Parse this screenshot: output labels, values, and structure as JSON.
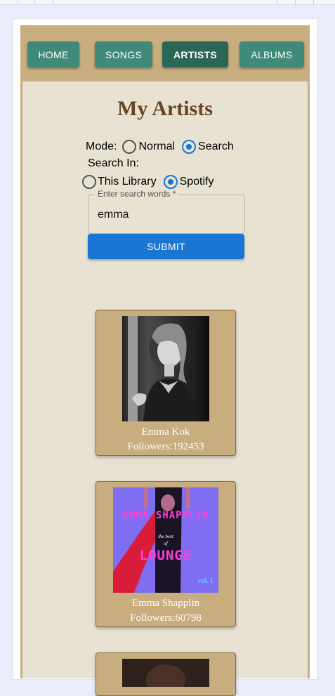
{
  "nav": {
    "items": [
      {
        "label": "HOME",
        "active": false
      },
      {
        "label": "SONGS",
        "active": false
      },
      {
        "label": "ARTISTS",
        "active": true
      },
      {
        "label": "ALBUMS",
        "active": false
      }
    ]
  },
  "main": {
    "title": "My Artists",
    "mode_label": "Mode:",
    "mode_options": [
      {
        "label": "Normal",
        "checked": false
      },
      {
        "label": "Search",
        "checked": true
      }
    ],
    "search_in_label": "Search In:",
    "search_in_options": [
      {
        "label": "This Library",
        "checked": false
      },
      {
        "label": "Spotify",
        "checked": true
      }
    ],
    "search_field": {
      "label": "Enter search words *",
      "value": "emma"
    },
    "submit_label": "SUBMIT"
  },
  "artists": [
    {
      "name": "Emma Kok",
      "followers": "Followers:192453"
    },
    {
      "name": "Emma Shapplin",
      "followers": "Followers:60798",
      "cover_text": [
        "EMMA SHAPPLIN",
        "the best",
        "of",
        "LOUNGE",
        "vol. I"
      ]
    },
    {
      "name": "",
      "followers": ""
    }
  ],
  "colors": {
    "app_bg": "#c8ad7f",
    "content_bg": "#e8e2d2",
    "nav_button": "#3f8a78",
    "nav_button_active": "#2b6656",
    "title": "#6a4424",
    "accent": "#1976d2"
  }
}
